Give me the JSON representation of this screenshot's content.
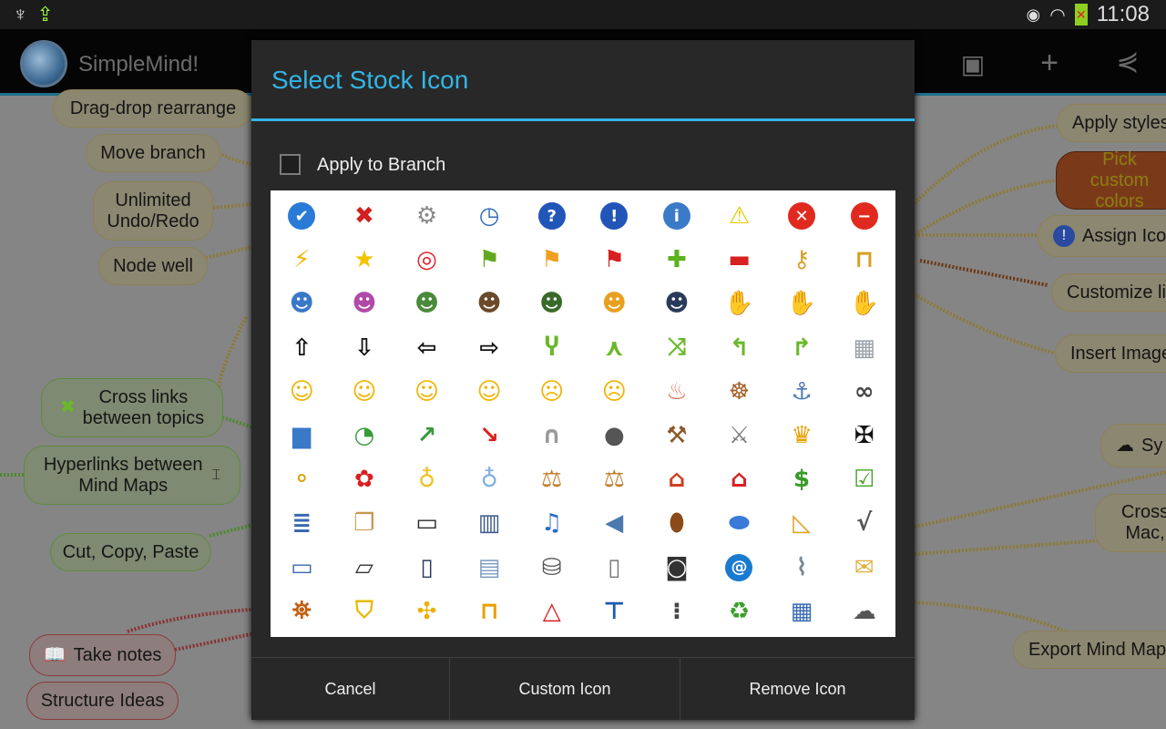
{
  "status_bar": {
    "time": "11:08",
    "left_icons": [
      "usb-icon",
      "screen-rotate-icon"
    ],
    "right_icons": [
      "eye-icon",
      "wifi-icon",
      "battery-icon"
    ]
  },
  "action_bar": {
    "app_title": "SimpleMind!",
    "actions": [
      "palette-icon",
      "add-icon",
      "share-icon"
    ]
  },
  "mindmap": {
    "nodes": [
      {
        "text": "Drag-drop rearrange",
        "style": "y"
      },
      {
        "text": "Move branch",
        "style": "y"
      },
      {
        "text": "Unlimited\nUndo/Redo",
        "style": "y"
      },
      {
        "text": "Node well",
        "style": "y"
      },
      {
        "text": "Cross links\nbetween topics",
        "style": "g"
      },
      {
        "text": "Hyperlinks between\nMind Maps",
        "style": "g"
      },
      {
        "text": "Cut, Copy, Paste",
        "style": "g"
      },
      {
        "text": "Take notes",
        "style": "rd"
      },
      {
        "text": "Structure Ideas",
        "style": "rd"
      },
      {
        "text": "Apply styles",
        "style": "y"
      },
      {
        "text": "Pick custom\ncolors",
        "style": "or"
      },
      {
        "text": "Assign Ico",
        "style": "y"
      },
      {
        "text": "Customize li",
        "style": "y"
      },
      {
        "text": "Insert Image",
        "style": "y"
      },
      {
        "text": "Sy",
        "style": "y"
      },
      {
        "text": "Cross\nMac,",
        "style": "y"
      },
      {
        "text": "Export Mind Map",
        "style": "y"
      }
    ]
  },
  "dialog": {
    "title": "Select Stock Icon",
    "apply_to_branch": {
      "label": "Apply to Branch",
      "checked": false
    },
    "buttons": {
      "cancel": "Cancel",
      "custom": "Custom Icon",
      "remove": "Remove Icon"
    },
    "accent": "#33b5e5",
    "icons": [
      {
        "name": "check",
        "color": "#2a7ad8"
      },
      {
        "name": "cross",
        "color": "#d21f1f"
      },
      {
        "name": "gear",
        "color": "#8a8a8a"
      },
      {
        "name": "clock",
        "color": "#2d6cb5"
      },
      {
        "name": "question",
        "color": "#2255b8"
      },
      {
        "name": "exclamation",
        "color": "#2255b8"
      },
      {
        "name": "info",
        "color": "#3a7bc8"
      },
      {
        "name": "warning",
        "color": "#e6c800"
      },
      {
        "name": "error",
        "color": "#e02a1f"
      },
      {
        "name": "no-entry",
        "color": "#e02a1f"
      },
      {
        "name": "lightning",
        "color": "#f0b400"
      },
      {
        "name": "star",
        "color": "#f4c400"
      },
      {
        "name": "target",
        "color": "#e0202a"
      },
      {
        "name": "flag-green",
        "color": "#62a81e"
      },
      {
        "name": "flag-orange",
        "color": "#f0a020"
      },
      {
        "name": "flag-red",
        "color": "#d82020"
      },
      {
        "name": "plus",
        "color": "#5db21d"
      },
      {
        "name": "minus",
        "color": "#d82020"
      },
      {
        "name": "key",
        "color": "#d8a030"
      },
      {
        "name": "lock",
        "color": "#d8a020"
      },
      {
        "name": "user-male",
        "color": "#3a78c8"
      },
      {
        "name": "user-female",
        "color": "#b04aa8"
      },
      {
        "name": "users",
        "color": "#4a8a3a"
      },
      {
        "name": "businessman",
        "color": "#6a4a2a"
      },
      {
        "name": "police",
        "color": "#3a6a2a"
      },
      {
        "name": "worker",
        "color": "#e8a020"
      },
      {
        "name": "graduate",
        "color": "#2a3a5a"
      },
      {
        "name": "thumbs-up",
        "color": "#f0b060"
      },
      {
        "name": "thumbs-down",
        "color": "#f0b060"
      },
      {
        "name": "handshake",
        "color": "#d8a060"
      },
      {
        "name": "arrow-up",
        "color": "#111111"
      },
      {
        "name": "arrow-down",
        "color": "#111111"
      },
      {
        "name": "arrow-left",
        "color": "#111111"
      },
      {
        "name": "arrow-right",
        "color": "#111111"
      },
      {
        "name": "split",
        "color": "#6ab82a"
      },
      {
        "name": "merge",
        "color": "#6ab82a"
      },
      {
        "name": "shuffle",
        "color": "#6ab82a"
      },
      {
        "name": "turn-left",
        "color": "#6ab82a"
      },
      {
        "name": "turn-right",
        "color": "#6ab82a"
      },
      {
        "name": "wall",
        "color": "#9aa0a8"
      },
      {
        "name": "smile",
        "color": "#f0b400"
      },
      {
        "name": "grin",
        "color": "#f0b400"
      },
      {
        "name": "wink",
        "color": "#f0b400"
      },
      {
        "name": "surprised",
        "color": "#f0b400"
      },
      {
        "name": "annoyed",
        "color": "#f0b400"
      },
      {
        "name": "cry",
        "color": "#f0b400"
      },
      {
        "name": "birthday-cake",
        "color": "#e07050"
      },
      {
        "name": "ship-wheel",
        "color": "#a0602a"
      },
      {
        "name": "anchor",
        "color": "#4a7ab0"
      },
      {
        "name": "binoculars",
        "color": "#444444"
      },
      {
        "name": "bar-chart",
        "color": "#3a78c8"
      },
      {
        "name": "pie-chart",
        "color": "#3a9a3a"
      },
      {
        "name": "chart-up",
        "color": "#3a9a3a"
      },
      {
        "name": "chart-down",
        "color": "#d82020"
      },
      {
        "name": "gravestone",
        "color": "#9a9a9a"
      },
      {
        "name": "bomb",
        "color": "#555555"
      },
      {
        "name": "axe",
        "color": "#8a5a2a"
      },
      {
        "name": "sword",
        "color": "#7a7a7a"
      },
      {
        "name": "crown",
        "color": "#e8a000"
      },
      {
        "name": "maltese-cross",
        "color": "#111111"
      },
      {
        "name": "medal",
        "color": "#d8a000"
      },
      {
        "name": "award-ribbon",
        "color": "#d82020"
      },
      {
        "name": "lightbulb-on",
        "color": "#f0c020"
      },
      {
        "name": "lightbulb-off",
        "color": "#80b0e0"
      },
      {
        "name": "scales",
        "color": "#c08030"
      },
      {
        "name": "scales-unbalanced",
        "color": "#c08030"
      },
      {
        "name": "house",
        "color": "#d04020"
      },
      {
        "name": "shop",
        "color": "#d82020"
      },
      {
        "name": "dollar",
        "color": "#3a9a2a"
      },
      {
        "name": "checklist",
        "color": "#4aa02a"
      },
      {
        "name": "books",
        "color": "#3a6ab0"
      },
      {
        "name": "open-book",
        "color": "#c89a50"
      },
      {
        "name": "blackboard",
        "color": "#2a2a2a"
      },
      {
        "name": "film",
        "color": "#3a5a8a"
      },
      {
        "name": "music",
        "color": "#2a6ac8"
      },
      {
        "name": "speaker",
        "color": "#4a7ab0"
      },
      {
        "name": "football",
        "color": "#8a4a1a"
      },
      {
        "name": "pill",
        "color": "#3a7ad8"
      },
      {
        "name": "set-square",
        "color": "#e0a020"
      },
      {
        "name": "square-root",
        "color": "#555555"
      },
      {
        "name": "desktop",
        "color": "#3a6ab0"
      },
      {
        "name": "laptop",
        "color": "#333333"
      },
      {
        "name": "tablet",
        "color": "#2a3a5a"
      },
      {
        "name": "document",
        "color": "#7a9ac0"
      },
      {
        "name": "database",
        "color": "#555555"
      },
      {
        "name": "mobile-phone",
        "color": "#777777"
      },
      {
        "name": "camera",
        "color": "#333333"
      },
      {
        "name": "at",
        "color": "#1a7ad0"
      },
      {
        "name": "paperclip",
        "color": "#7a8a9a"
      },
      {
        "name": "envelope",
        "color": "#e0b040"
      },
      {
        "name": "bug",
        "color": "#c06010"
      },
      {
        "name": "shield",
        "color": "#e8b800"
      },
      {
        "name": "puzzle",
        "color": "#f0b000"
      },
      {
        "name": "roadblock",
        "color": "#e8a000"
      },
      {
        "name": "road-work",
        "color": "#d82020"
      },
      {
        "name": "dead-end",
        "color": "#1a5ab0"
      },
      {
        "name": "traffic-light",
        "color": "#444444"
      },
      {
        "name": "recycle",
        "color": "#3aa02a"
      },
      {
        "name": "calendar",
        "color": "#3a6ab0"
      },
      {
        "name": "cloud",
        "color": "#555555"
      }
    ]
  }
}
